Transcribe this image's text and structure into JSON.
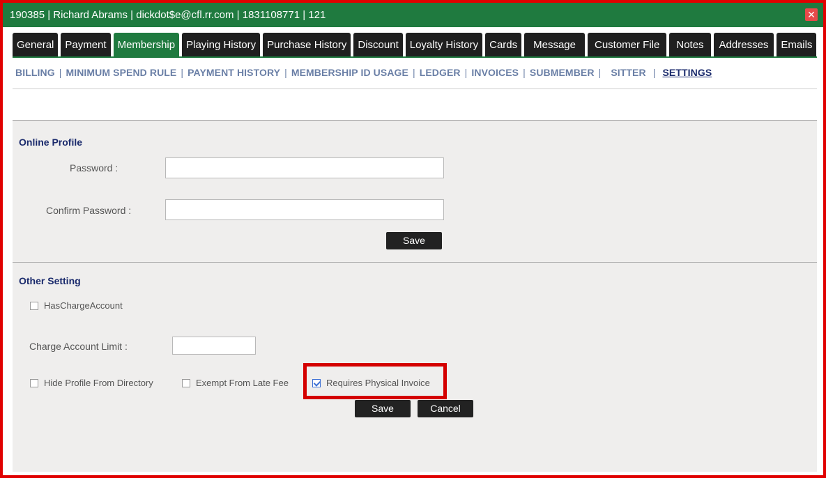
{
  "window": {
    "title": "190385 |  Richard Abrams | dickdot$e@cfl.rr.com | 1831108771 | 121",
    "close_icon": "close-icon"
  },
  "tabs": [
    {
      "label": "General"
    },
    {
      "label": "Payment"
    },
    {
      "label": "Membership",
      "active": true
    },
    {
      "label": "Playing History"
    },
    {
      "label": "Purchase History"
    },
    {
      "label": "Discount"
    },
    {
      "label": "Loyalty History"
    },
    {
      "label": "Cards"
    },
    {
      "label": "Message"
    },
    {
      "label": "Customer File"
    },
    {
      "label": "Notes"
    },
    {
      "label": "Addresses"
    },
    {
      "label": "Emails"
    }
  ],
  "subnav": [
    {
      "label": "BILLING"
    },
    {
      "label": "MINIMUM SPEND RULE"
    },
    {
      "label": "PAYMENT HISTORY"
    },
    {
      "label": "MEMBERSHIP ID USAGE"
    },
    {
      "label": "LEDGER"
    },
    {
      "label": "INVOICES"
    },
    {
      "label": "SUBMEMBER"
    },
    {
      "label": "SITTER"
    },
    {
      "label": "SETTINGS",
      "active": true
    }
  ],
  "online_profile": {
    "title": "Online Profile",
    "password_label": "Password :",
    "password_value": "",
    "confirm_label": "Confirm Password :",
    "confirm_value": "",
    "save_label": "Save"
  },
  "other_setting": {
    "title": "Other Setting",
    "has_charge_account": {
      "label": "HasChargeAccount",
      "checked": false
    },
    "charge_limit_label": "Charge Account Limit :",
    "charge_limit_value": "",
    "hide_profile": {
      "label": "Hide Profile From Directory",
      "checked": false
    },
    "exempt_late_fee": {
      "label": "Exempt From Late Fee",
      "checked": false
    },
    "requires_invoice": {
      "label": "Requires Physical Invoice",
      "checked": true
    },
    "save_label": "Save",
    "cancel_label": "Cancel"
  },
  "colors": {
    "header_green": "#1f7a3f",
    "tab_dark": "#1f1f1f",
    "frame_red": "#e00000",
    "subnav_blue": "#6a7fa6",
    "active_blue": "#1a2a6c"
  }
}
